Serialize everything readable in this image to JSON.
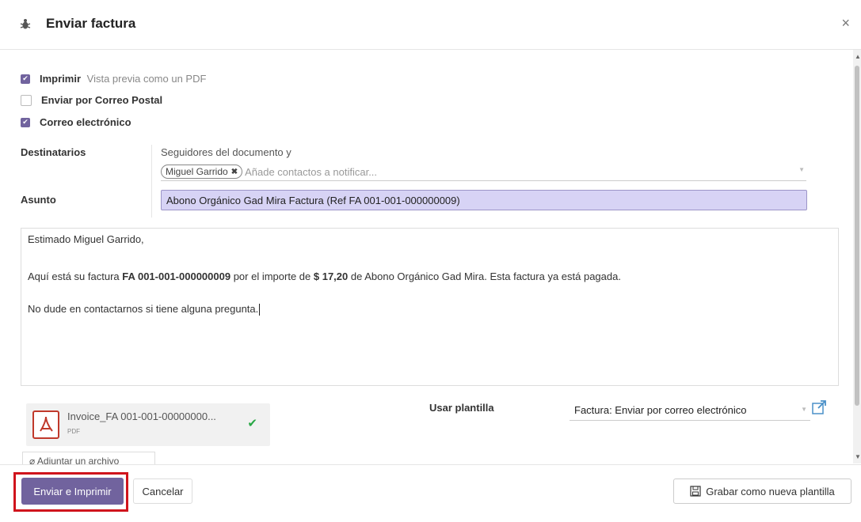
{
  "header": {
    "title": "Enviar factura",
    "icon": "bug-icon",
    "close_label": "×"
  },
  "options": {
    "print": {
      "label": "Imprimir",
      "hint": "Vista previa como un PDF",
      "checked": true
    },
    "postal": {
      "label": "Enviar por Correo Postal",
      "checked": false
    },
    "email": {
      "label": "Correo electrónico",
      "checked": true
    }
  },
  "recipients": {
    "label": "Destinatarios",
    "followers_text": "Seguidores del documento y",
    "tags": [
      "Miguel Garrido"
    ],
    "placeholder": "Añade contactos a notificar..."
  },
  "subject": {
    "label": "Asunto",
    "value": "Abono Orgánico Gad Mira Factura (Ref FA 001-001-000000009)"
  },
  "body": {
    "greeting": "Estimado Miguel Garrido,",
    "line2_prefix": "Aquí está su factura ",
    "line2_invoice": "FA 001-001-000000009",
    "line2_mid": " por el importe de ",
    "line2_amount": "$ 17,20",
    "line2_suffix": " de Abono Orgánico Gad Mira. Esta factura ya está pagada.",
    "line3": "No dude en contactarnos si tiene alguna pregunta."
  },
  "attachment": {
    "name": "Invoice_FA 001-001-00000000...",
    "type": "PDF",
    "add_label": "Adjuntar un archivo"
  },
  "template": {
    "label": "Usar plantilla",
    "value": "Factura: Enviar por correo electrónico"
  },
  "footer": {
    "send_print_label": "Enviar e Imprimir",
    "cancel_label": "Cancelar",
    "save_template_label": "Grabar como nueva plantilla"
  },
  "colors": {
    "primary": "#71639e",
    "highlight": "#d0141c",
    "subject_bg": "#d7d3f5"
  }
}
